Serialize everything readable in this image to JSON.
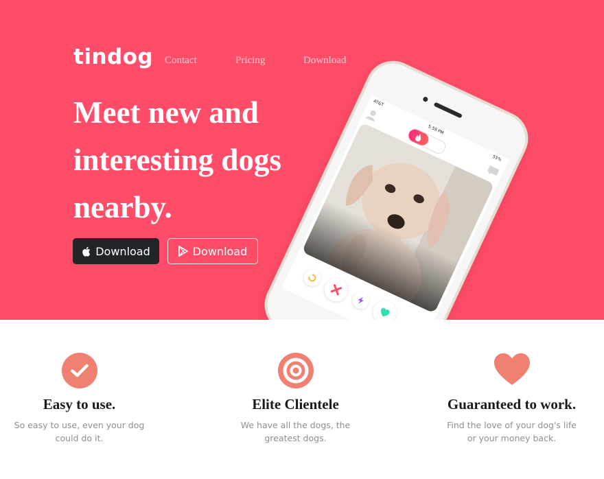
{
  "brand": "tindog",
  "nav": {
    "links": [
      "Contact",
      "Pricing",
      "Download"
    ]
  },
  "hero": {
    "headline": "Meet new and interesting dogs nearby.",
    "buttons": [
      {
        "label": "Download",
        "icon": "apple-icon",
        "style": "dark"
      },
      {
        "label": "Download",
        "icon": "google-play-icon",
        "style": "outline"
      }
    ]
  },
  "phone": {
    "carrier": "AT&T",
    "time": "5:59 PM",
    "battery": "55%",
    "actions": [
      "rewind-icon",
      "nope-icon",
      "boost-icon",
      "like-icon"
    ]
  },
  "features": [
    {
      "icon": "check-circle-icon",
      "title": "Easy to use.",
      "text": "So easy to use, even your dog could do it."
    },
    {
      "icon": "bullseye-icon",
      "title": "Elite Clientele",
      "text": "We have all the dogs, the greatest dogs."
    },
    {
      "icon": "heart-icon",
      "title": "Guaranteed to work.",
      "text": "Find the love of your dog's life or your money back."
    }
  ],
  "colors": {
    "hero_background": "#ff4c68",
    "feature_icon": "#ef8172",
    "dark_button": "#212529"
  }
}
